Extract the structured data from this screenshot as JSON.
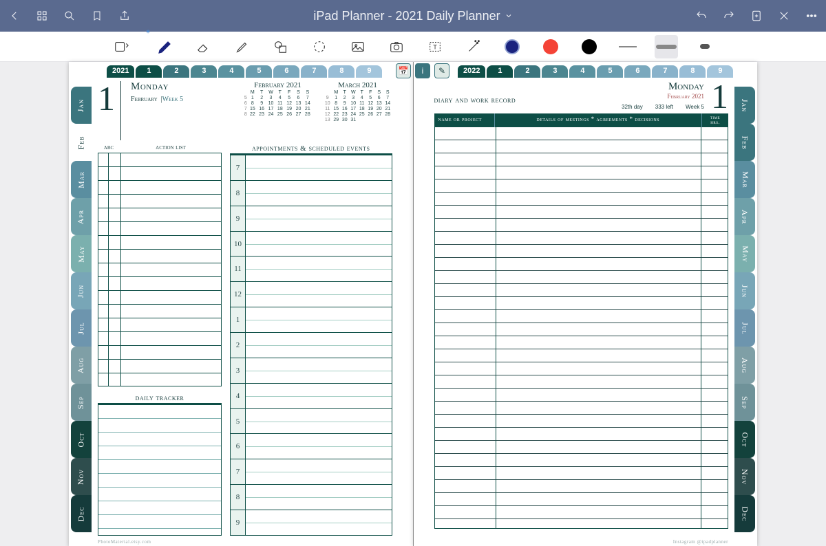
{
  "titlebar": {
    "title": "iPad Planner - 2021 Daily Planner"
  },
  "colors": {
    "accent": "#0d4e46"
  },
  "toptabs": {
    "year_left": "2021",
    "year_right": "2022",
    "nums": [
      "1",
      "2",
      "3",
      "4",
      "5",
      "6",
      "7",
      "8",
      "9"
    ]
  },
  "months": [
    "Jan",
    "Feb",
    "Mar",
    "Apr",
    "May",
    "Jun",
    "Jul",
    "Aug",
    "Sep",
    "Oct",
    "Nov",
    "Dec"
  ],
  "left_page": {
    "big_day": "1",
    "weekday": "Monday",
    "month_line": "February",
    "week_label": "Week 5",
    "minical": [
      {
        "title": "February 2021",
        "dow": [
          "M",
          "T",
          "W",
          "T",
          "F",
          "S",
          "S"
        ],
        "rows": [
          [
            "1",
            "2",
            "3",
            "4",
            "5",
            "6",
            "7"
          ],
          [
            "8",
            "9",
            "10",
            "11",
            "12",
            "13",
            "14"
          ],
          [
            "15",
            "16",
            "17",
            "18",
            "19",
            "20",
            "21"
          ],
          [
            "22",
            "23",
            "24",
            "25",
            "26",
            "27",
            "28"
          ]
        ],
        "weeknums": [
          "5",
          "6",
          "7",
          "8"
        ]
      },
      {
        "title": "March 2021",
        "dow": [
          "M",
          "T",
          "W",
          "T",
          "F",
          "S",
          "S"
        ],
        "rows": [
          [
            "1",
            "2",
            "3",
            "4",
            "5",
            "6",
            "7"
          ],
          [
            "8",
            "9",
            "10",
            "11",
            "12",
            "13",
            "14"
          ],
          [
            "15",
            "16",
            "17",
            "18",
            "19",
            "20",
            "21"
          ],
          [
            "22",
            "23",
            "24",
            "25",
            "26",
            "27",
            "28"
          ],
          [
            "29",
            "30",
            "31",
            "",
            "",
            "",
            ""
          ]
        ],
        "weeknums": [
          "9",
          "10",
          "11",
          "12",
          "13"
        ]
      }
    ],
    "action_list": {
      "abc": "abc",
      "title": "action  list"
    },
    "daily_tracker": "daily tracker",
    "appts_title": "appointments & scheduled events",
    "hours": [
      "7",
      "8",
      "9",
      "10",
      "11",
      "12",
      "1",
      "2",
      "3",
      "4",
      "5",
      "6",
      "7",
      "8",
      "9"
    ],
    "footer": "PhotoMaterial.etsy.com"
  },
  "right_page": {
    "diary_title": "diary and work record",
    "weekday": "Monday",
    "month_line": "February 2021",
    "big_day": "1",
    "day_count": "32th day",
    "days_left": "333 left",
    "week_label": "Week 5",
    "cols": {
      "c1": "name or project",
      "c2": "details of meetings * agreements * decisions",
      "c3": "time\nhrs."
    },
    "footer": "Instagram @ipadplanner"
  }
}
